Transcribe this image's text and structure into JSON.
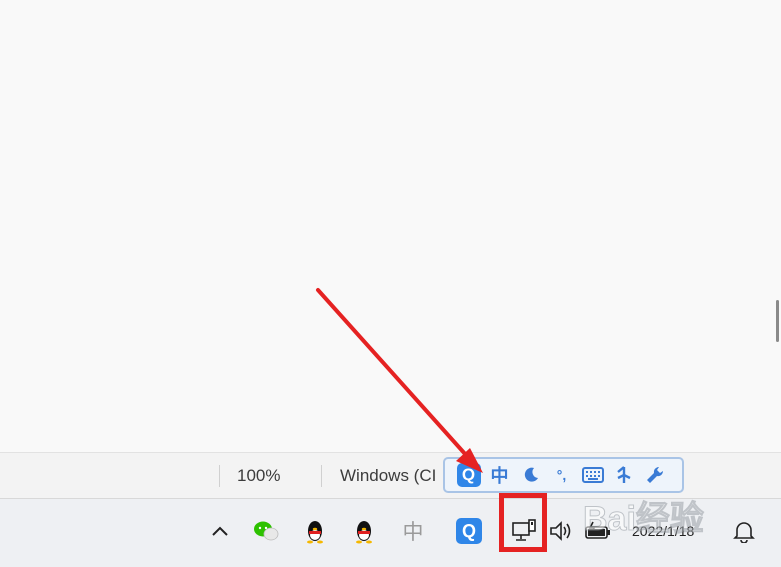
{
  "statusbar": {
    "zoom": "100%",
    "encoding": "Windows (CI"
  },
  "ime": {
    "logo": "Q",
    "lang": "中",
    "moon": "moon-icon",
    "punct": "°,",
    "keyboard": "keyboard-icon",
    "split": "split-icon",
    "tools": "wrench-icon"
  },
  "taskbar": {
    "tray_chevron": "chevron-up-icon",
    "items": [
      "wechat-icon",
      "qq-icon",
      "qq-icon",
      "chinese-input-icon",
      "sogou-q-icon",
      "network-icon",
      "volume-icon",
      "battery-icon",
      "notification-icon"
    ],
    "chinese_label": "中",
    "sogou_label": "Q",
    "clock": "2022/1/18"
  },
  "watermark": {
    "text": "Bai经验"
  },
  "colors": {
    "accent_red": "#e52222",
    "ime_blue": "#2f86e8"
  }
}
